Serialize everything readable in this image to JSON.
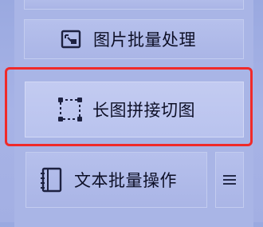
{
  "buttons": {
    "image_batch": {
      "label": "图片批量处理",
      "icon": "image-crop-icon"
    },
    "long_image": {
      "label": "长图拼接切图",
      "icon": "selection-frame-icon"
    },
    "text_batch": {
      "label": "文本批量操作",
      "icon": "document-icon"
    },
    "more_menu": {
      "icon": "menu-lines-icon"
    }
  },
  "colors": {
    "panel_bg": "#a9b5e6",
    "button_bg": "#b6c0ec",
    "selected_button_bg": "#c3cbf1",
    "highlight_border": "#f02a2a",
    "text": "#0d0f26"
  },
  "state": {
    "highlighted": "long_image"
  }
}
